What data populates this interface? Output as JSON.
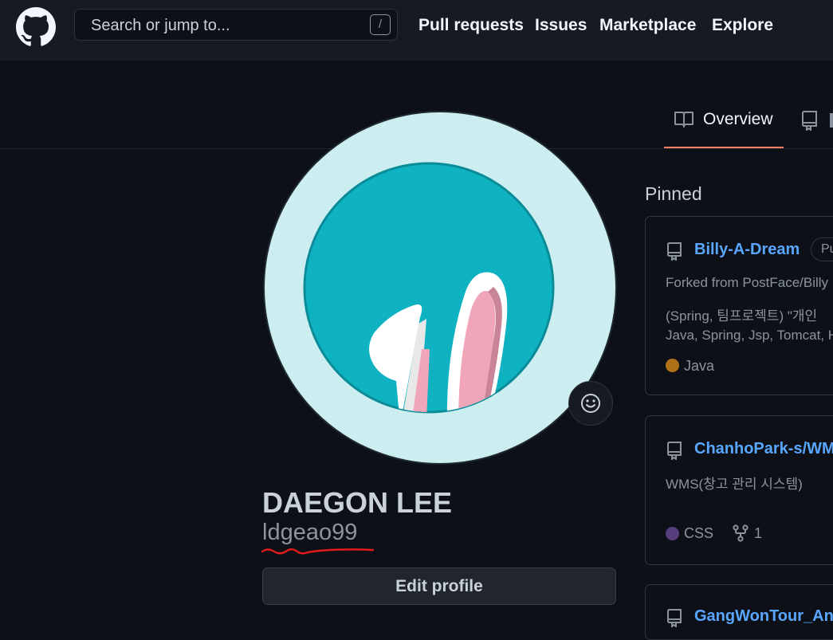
{
  "header": {
    "search_placeholder": "Search or jump to...",
    "search_shortcut": "/",
    "nav": [
      "Pull requests",
      "Issues",
      "Marketplace",
      "Explore"
    ]
  },
  "tabs": {
    "overview": "Overview"
  },
  "profile": {
    "full_name": "DAEGON LEE",
    "username": "ldgeao99",
    "edit_button": "Edit profile"
  },
  "pinned": {
    "title": "Pinned",
    "cards": [
      {
        "name": "Billy-A-Dream",
        "badge": "Pu",
        "fork_source": "Forked from PostFace/Billy",
        "description": "(Spring, 팀프로젝트) \"개인",
        "topics": "Java, Spring, Jsp, Tomcat, H",
        "language": "Java",
        "language_color": "#b07219"
      },
      {
        "name": "ChanhoPark-s/WM",
        "description": "WMS(창고 관리 시스템)",
        "language": "CSS",
        "language_color": "#563d7c",
        "forks": "1"
      },
      {
        "name": "GangWonTour_And"
      }
    ]
  },
  "colors": {
    "background": "#0d1117",
    "header_bg": "#161b22",
    "link": "#58a6ff",
    "tab_underline": "#f78166",
    "avatar_ring": "#cdeef0",
    "avatar_inner": "#0fb2c1"
  }
}
